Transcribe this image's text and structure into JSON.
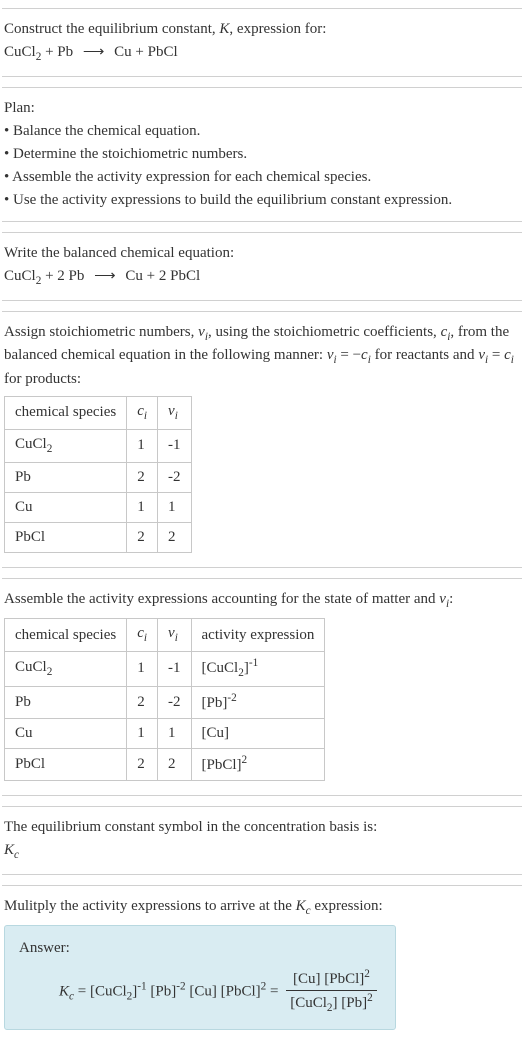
{
  "intro": {
    "line1_a": "Construct the equilibrium constant, ",
    "line1_b": ", expression for:",
    "eq_lhs1": "CuCl",
    "eq_lhs2": " + Pb",
    "eq_rhs": "Cu + PbCl"
  },
  "plan": {
    "title": "Plan:",
    "b1": "• Balance the chemical equation.",
    "b2": "• Determine the stoichiometric numbers.",
    "b3": "• Assemble the activity expression for each chemical species.",
    "b4": "• Use the activity expressions to build the equilibrium constant expression."
  },
  "balanced": {
    "title": "Write the balanced chemical equation:",
    "lhs_a": "CuCl",
    "lhs_b": " + 2 Pb",
    "rhs": "Cu + 2 PbCl"
  },
  "assign": {
    "txt_a": "Assign stoichiometric numbers, ",
    "txt_b": ", using the stoichiometric coefficients, ",
    "txt_c": ", from the balanced chemical equation in the following manner: ",
    "txt_d": " for reactants and ",
    "txt_e": " for products:",
    "th1": "chemical species",
    "rows": [
      {
        "sp": "CuCl",
        "sub": "2",
        "c": "1",
        "v": "-1"
      },
      {
        "sp": "Pb",
        "sub": "",
        "c": "2",
        "v": "-2"
      },
      {
        "sp": "Cu",
        "sub": "",
        "c": "1",
        "v": "1"
      },
      {
        "sp": "PbCl",
        "sub": "",
        "c": "2",
        "v": "2"
      }
    ]
  },
  "activity": {
    "txt_a": "Assemble the activity expressions accounting for the state of matter and ",
    "txt_b": ":",
    "th1": "chemical species",
    "th4": "activity expression",
    "rows": [
      {
        "sp": "CuCl",
        "sub": "2",
        "c": "1",
        "v": "-1",
        "ae_a": "[CuCl",
        "ae_sub": "2",
        "ae_b": "]",
        "ae_sup": "-1"
      },
      {
        "sp": "Pb",
        "sub": "",
        "c": "2",
        "v": "-2",
        "ae_a": "[Pb]",
        "ae_sub": "",
        "ae_b": "",
        "ae_sup": "-2"
      },
      {
        "sp": "Cu",
        "sub": "",
        "c": "1",
        "v": "1",
        "ae_a": "[Cu]",
        "ae_sub": "",
        "ae_b": "",
        "ae_sup": ""
      },
      {
        "sp": "PbCl",
        "sub": "",
        "c": "2",
        "v": "2",
        "ae_a": "[PbCl]",
        "ae_sub": "",
        "ae_b": "",
        "ae_sup": "2"
      }
    ]
  },
  "symbol": {
    "txt": "The equilibrium constant symbol in the concentration basis is:"
  },
  "mult": {
    "txt_a": "Mulitply the activity expressions to arrive at the ",
    "txt_b": " expression:"
  },
  "answer": {
    "label": "Answer:",
    "eq_left_a": " = [CuCl",
    "eq_left_b": "]",
    "eq_left_c": " [Pb]",
    "eq_left_d": " [Cu] [PbCl]",
    "eq_left_e": " = ",
    "num_a": "[Cu] [PbCl]",
    "den_a": "[CuCl",
    "den_b": "] [Pb]",
    "sup_n1": "-1",
    "sup_n2": "-2",
    "sup_2": "2"
  },
  "sym": {
    "K": "K",
    "Kc_sub": "c",
    "nu": "ν",
    "ci": "c",
    "i": "i",
    "two": "2",
    "arrow": "⟶",
    "eq_reactants": "ν",
    "eq_sign": " = −",
    "eq_sign2": " = "
  }
}
